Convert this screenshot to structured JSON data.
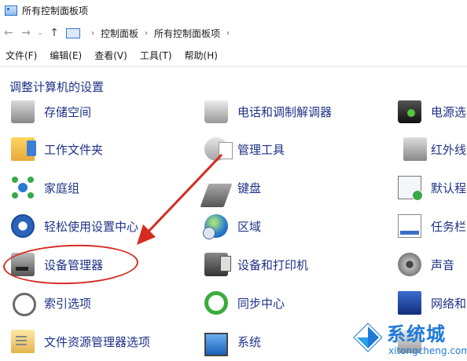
{
  "window": {
    "title": "所有控制面板项"
  },
  "nav": {
    "back_icon": "arrow-left-icon",
    "forward_icon": "arrow-right-icon",
    "history_icon": "chevron-down-icon",
    "up_icon": "arrow-up-icon",
    "breadcrumb": [
      "控制面板",
      "所有控制面板项"
    ],
    "breadcrumb_sep": "›"
  },
  "menu": [
    "文件(F)",
    "编辑(E)",
    "查看(V)",
    "工具(T)",
    "帮助(H)"
  ],
  "heading": "调整计算机的设置",
  "items": {
    "col1": [
      "存储空间",
      "工作文件夹",
      "家庭组",
      "轻松使用设置中心",
      "设备管理器",
      "索引选项",
      "文件资源管理器选项"
    ],
    "col2": [
      "电话和调制解调器",
      "管理工具",
      "键盘",
      "区域",
      "设备和打印机",
      "同步中心",
      "系统"
    ],
    "col3": [
      "电源选",
      "红外线",
      "默认程",
      "任务栏",
      "声音",
      "网络和"
    ]
  },
  "annotation": {
    "highlight_color": "#d62b20",
    "highlighted_item": "设备管理器"
  },
  "watermark": {
    "brand": "系统城",
    "site": "xitongcheng.com"
  },
  "colors": {
    "link": "#1e3287",
    "heading": "#1e3287",
    "accent": "#1e7ad8"
  }
}
